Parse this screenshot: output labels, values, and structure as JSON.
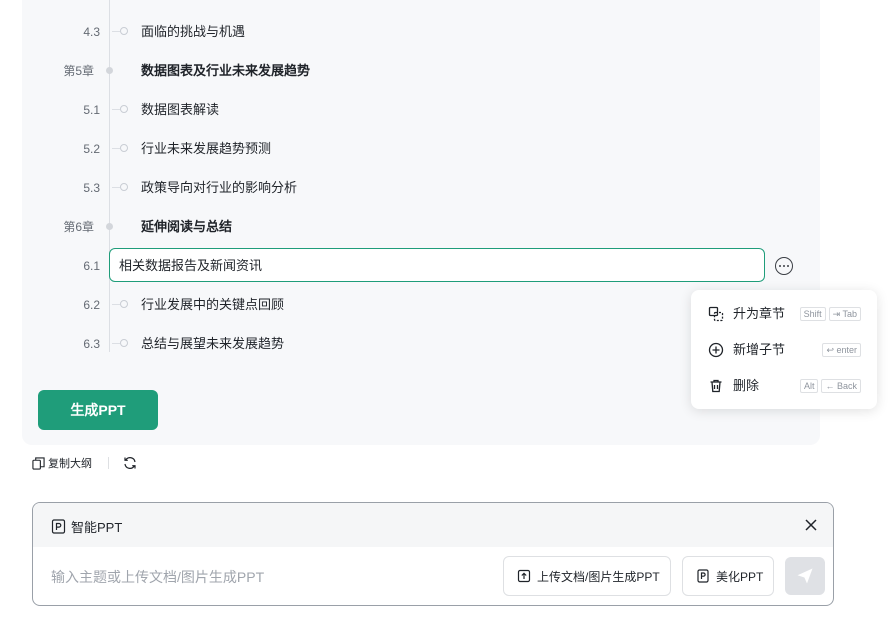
{
  "outline": {
    "rows": [
      {
        "num": "4.3",
        "title": "面临的挑战与机遇",
        "type": "sub"
      },
      {
        "num": "第5章",
        "title": "数据图表及行业未来发展趋势",
        "type": "chapter"
      },
      {
        "num": "5.1",
        "title": "数据图表解读",
        "type": "sub"
      },
      {
        "num": "5.2",
        "title": "行业未来发展趋势预测",
        "type": "sub"
      },
      {
        "num": "5.3",
        "title": "政策导向对行业的影响分析",
        "type": "sub"
      },
      {
        "num": "第6章",
        "title": "延伸阅读与总结",
        "type": "chapter"
      },
      {
        "num": "6.1",
        "title": "",
        "type": "sub"
      },
      {
        "num": "6.2",
        "title": "行业发展中的关键点回顾",
        "type": "sub"
      },
      {
        "num": "6.3",
        "title": "总结与展望未来发展趋势",
        "type": "sub"
      }
    ],
    "editing_value": "相关数据报告及新闻资讯",
    "generate_label": "生成PPT"
  },
  "context_menu": {
    "items": [
      {
        "label": "升为章节",
        "icon": "promote-icon",
        "keys": [
          "Shift",
          "⇥ Tab"
        ]
      },
      {
        "label": "新增子节",
        "icon": "plus-circle-icon",
        "keys": [
          "↩ enter"
        ]
      },
      {
        "label": "删除",
        "icon": "trash-icon",
        "keys": [
          "Alt",
          "← Back"
        ]
      }
    ]
  },
  "toolbar": {
    "copy_label": "复制大纲"
  },
  "chat": {
    "tag_label": "智能PPT",
    "input_value": "",
    "input_placeholder": "输入主题或上传文档/图片生成PPT",
    "upload_label": "上传文档/图片生成PPT",
    "beautify_label": "美化PPT"
  },
  "colors": {
    "accent": "#1f9d7a",
    "panel_bg": "#f7f8fa"
  }
}
